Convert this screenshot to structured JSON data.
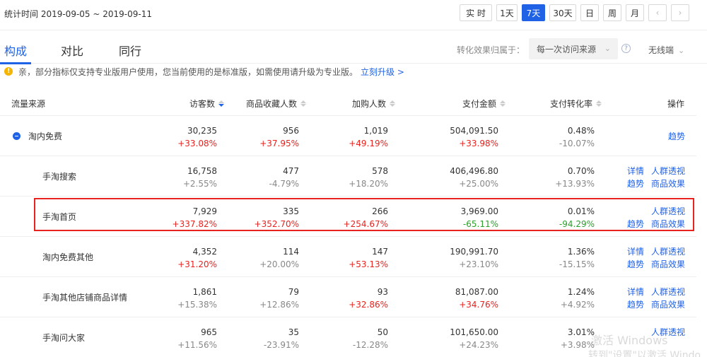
{
  "header": {
    "stat_time": "统计时间 2019-09-05 ~ 2019-09-11",
    "ranges": [
      {
        "label": "实 时",
        "active": false
      },
      {
        "label": "1天",
        "active": false
      },
      {
        "label": "7天",
        "active": true
      },
      {
        "label": "30天",
        "active": false
      },
      {
        "label": "日",
        "active": false
      },
      {
        "label": "周",
        "active": false
      },
      {
        "label": "月",
        "active": false
      }
    ],
    "prev_icon": "chevron-left-icon",
    "next_icon": "chevron-right-icon",
    "prev_glyph": "‹",
    "next_glyph": "›"
  },
  "tabs": [
    {
      "label": "构成",
      "active": true
    },
    {
      "label": "对比",
      "active": false
    },
    {
      "label": "同行",
      "active": false
    }
  ],
  "attribution": {
    "label": "转化效果归属于：",
    "selected": "每一次访问来源",
    "help_glyph": "?",
    "device": "无线端"
  },
  "notice": {
    "text": "亲，部分指标仅支持专业版用户使用，您当前使用的是标准版，如需使用请升级为专业版。",
    "link": "立刻升级 >"
  },
  "table": {
    "columns": {
      "source": "流量来源",
      "visitors": "访客数",
      "favorites": "商品收藏人数",
      "cart": "加购人数",
      "payment": "支付金额",
      "conversion": "支付转化率",
      "actions": "操作"
    },
    "rows": [
      {
        "name": "淘内免费",
        "group": true,
        "visitors": "30,235",
        "visitors_chg": "+33.08%",
        "favorites": "956",
        "favorites_chg": "+37.95%",
        "cart": "1,019",
        "cart_chg": "+49.19%",
        "payment": "504,091.50",
        "payment_chg": "+33.98%",
        "conversion": "0.48%",
        "conversion_chg": "-10.07%",
        "actions": {
          "detail": "",
          "crowd": "",
          "trend": "趋势",
          "effect": ""
        }
      },
      {
        "name": "手淘搜索",
        "group": false,
        "visitors": "16,758",
        "visitors_chg": "+2.55%",
        "favorites": "477",
        "favorites_chg": "-4.79%",
        "cart": "578",
        "cart_chg": "+18.20%",
        "payment": "406,496.80",
        "payment_chg": "+25.00%",
        "conversion": "0.70%",
        "conversion_chg": "+13.93%",
        "actions": {
          "detail": "详情",
          "crowd": "人群透视",
          "trend": "趋势",
          "effect": "商品效果"
        }
      },
      {
        "name": "手淘首页",
        "group": false,
        "visitors": "7,929",
        "visitors_chg": "+337.82%",
        "favorites": "335",
        "favorites_chg": "+352.70%",
        "cart": "266",
        "cart_chg": "+254.67%",
        "payment": "3,969.00",
        "payment_chg": "-65.11%",
        "conversion": "0.01%",
        "conversion_chg": "-94.29%",
        "actions": {
          "detail": "",
          "crowd": "人群透视",
          "trend": "趋势",
          "effect": "商品效果"
        }
      },
      {
        "name": "淘内免费其他",
        "group": false,
        "visitors": "4,352",
        "visitors_chg": "+31.20%",
        "favorites": "114",
        "favorites_chg": "+20.00%",
        "cart": "147",
        "cart_chg": "+53.13%",
        "payment": "190,991.70",
        "payment_chg": "+23.10%",
        "conversion": "1.36%",
        "conversion_chg": "-15.15%",
        "actions": {
          "detail": "详情",
          "crowd": "人群透视",
          "trend": "趋势",
          "effect": "商品效果"
        }
      },
      {
        "name": "手淘其他店铺商品详情",
        "group": false,
        "visitors": "1,861",
        "visitors_chg": "+15.38%",
        "favorites": "79",
        "favorites_chg": "+12.86%",
        "cart": "93",
        "cart_chg": "+32.86%",
        "payment": "81,087.00",
        "payment_chg": "+34.76%",
        "conversion": "1.24%",
        "conversion_chg": "+4.92%",
        "actions": {
          "detail": "详情",
          "crowd": "人群透视",
          "trend": "趋势",
          "effect": "商品效果"
        }
      },
      {
        "name": "手淘问大家",
        "group": false,
        "visitors": "965",
        "visitors_chg": "+11.56%",
        "favorites": "35",
        "favorites_chg": "-23.91%",
        "cart": "50",
        "cart_chg": "-12.28%",
        "payment": "101,650.00",
        "payment_chg": "+24.23%",
        "conversion": "3.01%",
        "conversion_chg": "+3.98%",
        "actions": {
          "detail": "",
          "crowd": "人群透视",
          "trend": "",
          "effect": ""
        }
      }
    ],
    "highlighted_row": "手淘首页"
  },
  "watermark": {
    "line1": "激活 Windows",
    "line2": "转到\"设置\"以激活 Windo"
  }
}
